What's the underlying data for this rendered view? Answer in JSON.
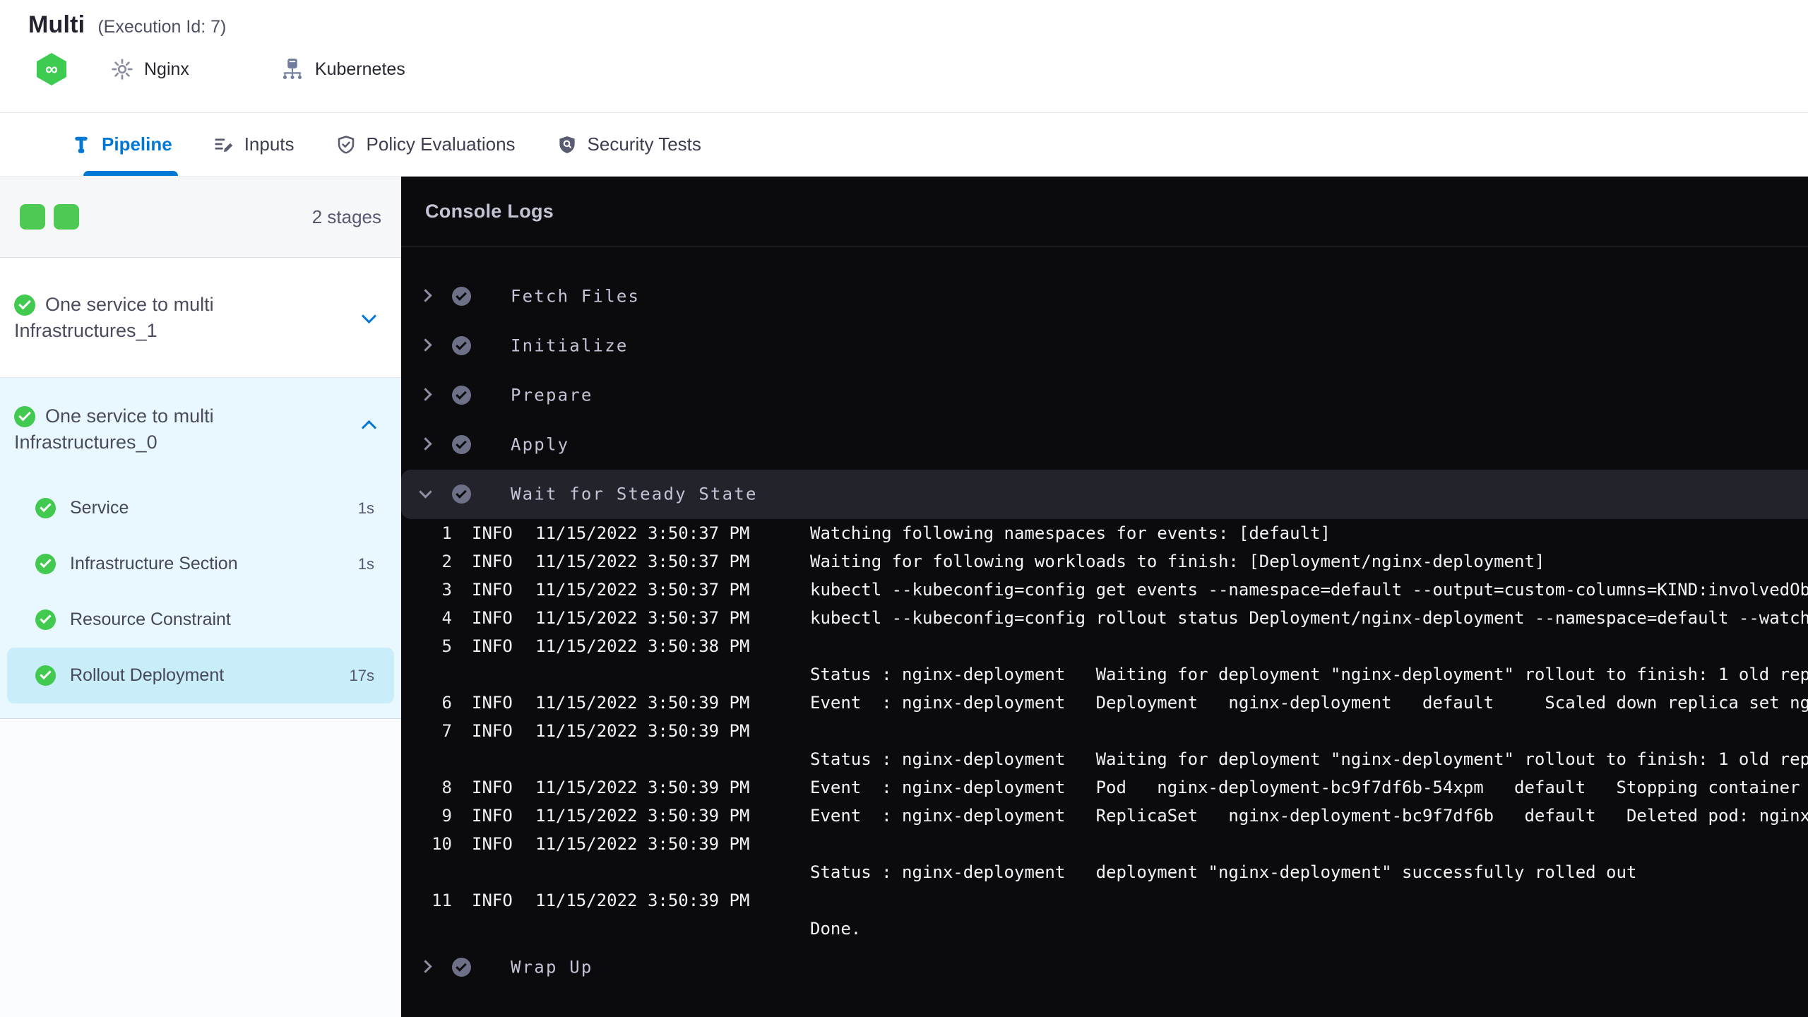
{
  "header": {
    "title": "Multi",
    "execution_id": "(Execution Id: 7)",
    "service_label": "Nginx",
    "environment_label": "Kubernetes",
    "harness_icon_glyph": "∞"
  },
  "tabs": [
    {
      "label": "Pipeline",
      "active": true
    },
    {
      "label": "Inputs",
      "active": false
    },
    {
      "label": "Policy Evaluations",
      "active": false
    },
    {
      "label": "Security Tests",
      "active": false
    }
  ],
  "sidebar": {
    "stage_count_label": "2 stages",
    "stages": [
      {
        "name": "One service to multi Infrastructures_1",
        "status": "success",
        "expanded": false
      },
      {
        "name": "One service to multi Infrastructures_0",
        "status": "success",
        "expanded": true,
        "steps": [
          {
            "name": "Service",
            "duration": "1s",
            "selected": false
          },
          {
            "name": "Infrastructure Section",
            "duration": "1s",
            "selected": false
          },
          {
            "name": "Resource Constraint",
            "duration": "",
            "selected": false
          },
          {
            "name": "Rollout Deployment",
            "duration": "17s",
            "selected": true
          }
        ]
      }
    ]
  },
  "console": {
    "title": "Console Logs",
    "steps": [
      {
        "name": "Fetch Files",
        "state": "collapsed"
      },
      {
        "name": "Initialize",
        "state": "collapsed"
      },
      {
        "name": "Prepare",
        "state": "collapsed"
      },
      {
        "name": "Apply",
        "state": "collapsed"
      },
      {
        "name": "Wait for Steady State",
        "state": "expanded",
        "logs": [
          {
            "no": "1",
            "level": "INFO",
            "time": "11/15/2022 3:50:37 PM",
            "message": "Watching following namespaces for events: [default]"
          },
          {
            "no": "2",
            "level": "INFO",
            "time": "11/15/2022 3:50:37 PM",
            "message": "Waiting for following workloads to finish: [Deployment/nginx-deployment]"
          },
          {
            "no": "3",
            "level": "INFO",
            "time": "11/15/2022 3:50:37 PM",
            "message": "kubectl --kubeconfig=config get events --namespace=default --output=custom-columns=KIND:involvedOb"
          },
          {
            "no": "4",
            "level": "INFO",
            "time": "11/15/2022 3:50:37 PM",
            "message": "kubectl --kubeconfig=config rollout status Deployment/nginx-deployment --namespace=default --watch"
          },
          {
            "no": "5",
            "level": "INFO",
            "time": "11/15/2022 3:50:38 PM",
            "message": ""
          },
          {
            "no": "",
            "level": "",
            "time": "",
            "message": "Status : nginx-deployment   Waiting for deployment \"nginx-deployment\" rollout to finish: 1 old rep"
          },
          {
            "no": "6",
            "level": "INFO",
            "time": "11/15/2022 3:50:39 PM",
            "message": "Event  : nginx-deployment   Deployment   nginx-deployment   default     Scaled down replica set ng"
          },
          {
            "no": "7",
            "level": "INFO",
            "time": "11/15/2022 3:50:39 PM",
            "message": ""
          },
          {
            "no": "",
            "level": "",
            "time": "",
            "message": "Status : nginx-deployment   Waiting for deployment \"nginx-deployment\" rollout to finish: 1 old rep"
          },
          {
            "no": "8",
            "level": "INFO",
            "time": "11/15/2022 3:50:39 PM",
            "message": "Event  : nginx-deployment   Pod   nginx-deployment-bc9f7df6b-54xpm   default   Stopping container"
          },
          {
            "no": "9",
            "level": "INFO",
            "time": "11/15/2022 3:50:39 PM",
            "message": "Event  : nginx-deployment   ReplicaSet   nginx-deployment-bc9f7df6b   default   Deleted pod: nginx"
          },
          {
            "no": "10",
            "level": "INFO",
            "time": "11/15/2022 3:50:39 PM",
            "message": ""
          },
          {
            "no": "",
            "level": "",
            "time": "",
            "message": "Status : nginx-deployment   deployment \"nginx-deployment\" successfully rolled out"
          },
          {
            "no": "11",
            "level": "INFO",
            "time": "11/15/2022 3:50:39 PM",
            "message": ""
          },
          {
            "no": "",
            "level": "",
            "time": "",
            "message": "Done."
          }
        ]
      },
      {
        "name": "Wrap Up",
        "state": "collapsed"
      }
    ]
  },
  "colors": {
    "accent_blue": "#0278d5",
    "success_green": "#4ec952",
    "console_bg": "#0b0b0e",
    "console_row_highlight": "#23232c",
    "sidebar_expanded_bg": "#e9f8fe",
    "sidebar_selected_bg": "#c9edf9"
  }
}
